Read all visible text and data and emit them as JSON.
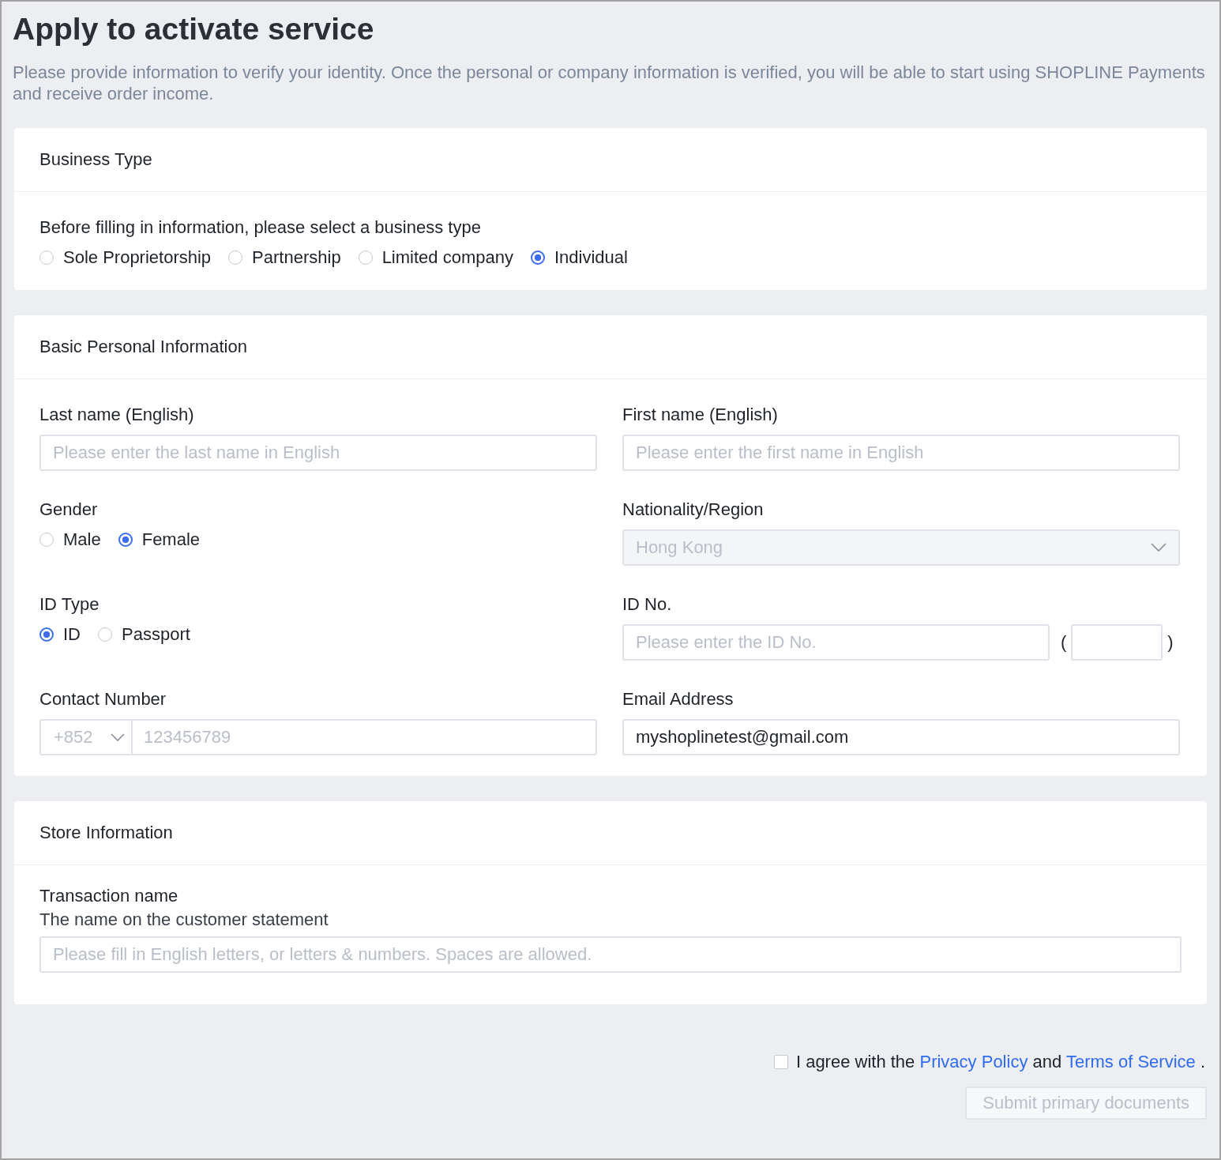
{
  "page": {
    "title": "Apply to activate service",
    "description": "Please provide information to verify your identity. Once the personal or company information is verified, you will be able to start using SHOPLINE Payments and receive order income."
  },
  "business_type": {
    "title": "Business Type",
    "prompt": "Before filling in information, please select a business type",
    "options": [
      {
        "label": "Sole Proprietorship",
        "selected": false
      },
      {
        "label": "Partnership",
        "selected": false
      },
      {
        "label": "Limited company",
        "selected": false
      },
      {
        "label": "Individual",
        "selected": true
      }
    ]
  },
  "personal": {
    "title": "Basic Personal Information",
    "last_name": {
      "label": "Last name (English)",
      "placeholder": "Please enter the last name in English"
    },
    "first_name": {
      "label": "First name (English)",
      "placeholder": "Please enter the first name in English"
    },
    "gender": {
      "label": "Gender",
      "options": [
        {
          "label": "Male",
          "selected": false
        },
        {
          "label": "Female",
          "selected": true
        }
      ]
    },
    "nationality": {
      "label": "Nationality/Region",
      "value": "Hong Kong",
      "disabled": true
    },
    "id_type": {
      "label": "ID Type",
      "options": [
        {
          "label": "ID",
          "selected": true
        },
        {
          "label": "Passport",
          "selected": false
        }
      ]
    },
    "id_no": {
      "label": "ID No.",
      "placeholder": "Please enter the ID No.",
      "open_paren": "(",
      "close_paren": ")"
    },
    "contact": {
      "label": "Contact Number",
      "code": "+852",
      "code_disabled": true,
      "placeholder": "123456789"
    },
    "email": {
      "label": "Email Address",
      "value": "myshoplinetest@gmail.com"
    }
  },
  "store": {
    "title": "Store Information",
    "transaction": {
      "label": "Transaction name",
      "hint": "The name on the customer statement",
      "placeholder": "Please fill in English letters, or letters & numbers. Spaces are allowed."
    }
  },
  "agreement": {
    "checked": false,
    "text": "I agree with the",
    "privacy_link": "Privacy Policy",
    "joiner": "and",
    "terms_link": "Terms of Service",
    "end": "."
  },
  "submit": {
    "label": "Submit primary documents",
    "disabled": true
  }
}
